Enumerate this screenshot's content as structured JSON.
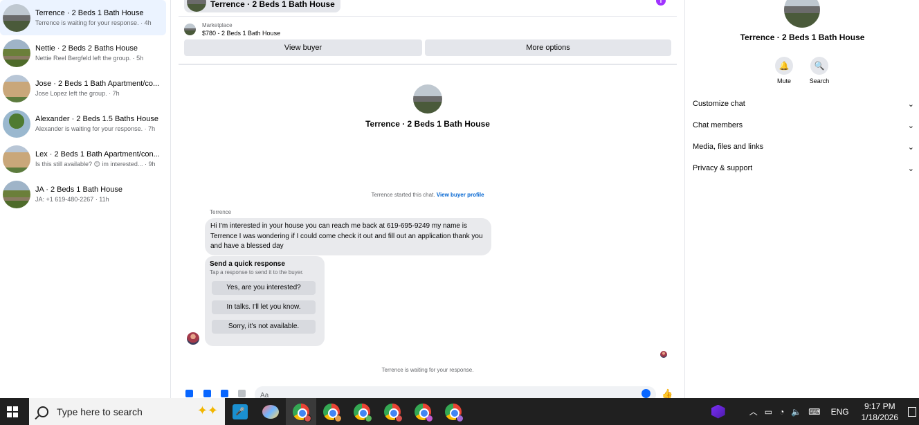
{
  "conversations": [
    {
      "title": "Terrence · 2 Beds 1 Bath House",
      "subtitle": "Terrence is waiting for your response. · 4h",
      "active": true
    },
    {
      "title": "Nettie · 2 Beds 2 Baths House",
      "subtitle": "Nettie Reel Bergfeld left the group. · 5h",
      "active": false
    },
    {
      "title": "Jose · 2 Beds 1 Bath Apartment/co...",
      "subtitle": "Jose Lopez left the group. · 7h",
      "active": false
    },
    {
      "title": "Alexander · 2 Beds 1.5 Baths House",
      "subtitle": "Alexander is waiting for your response. · 7h",
      "active": false
    },
    {
      "title": "Lex · 2 Beds 1 Bath Apartment/con...",
      "subtitle": "Is this still available? 😊 im interested... · 9h",
      "active": false
    },
    {
      "title": "JA · 2 Beds 1 Bath House",
      "subtitle": "JA: +1 619-480-2267 · 11h",
      "active": false
    }
  ],
  "chat": {
    "header_title": "Terrence · 2 Beds 1 Bath House",
    "marketplace_label": "Marketplace",
    "listing": "$780 - 2 Beds 1 Bath House",
    "view_buyer": "View buyer",
    "more_options": "More options",
    "big_name": "Terrence · 2 Beds 1 Bath House",
    "started_text": "Terrence started this chat.",
    "view_buyer_profile": "View buyer profile",
    "sender": "Terrence",
    "message": "Hi I'm interested in your house you can reach me back at 619-695-9249 my name is Terrence I was wondering if I could come check it out and fill out an application thank you and have a blessed day",
    "quick_response_title": "Send a quick response",
    "quick_response_sub": "Tap a response to send it to the buyer.",
    "quick_options": [
      "Yes, are you interested?",
      "In talks. I'll let you know.",
      "Sorry, it's not available."
    ],
    "waiting_text": "Terrence is waiting for your response.",
    "composer_placeholder": "Aa"
  },
  "right_panel": {
    "name": "Terrence · 2 Beds 1 Bath House",
    "mute": "Mute",
    "search": "Search",
    "sections": [
      "Customize chat",
      "Chat members",
      "Media, files and links",
      "Privacy & support"
    ]
  },
  "taskbar": {
    "search_placeholder": "Type here to search",
    "lang": "ENG",
    "time": "9:17 PM",
    "date": "1/18/2026"
  }
}
